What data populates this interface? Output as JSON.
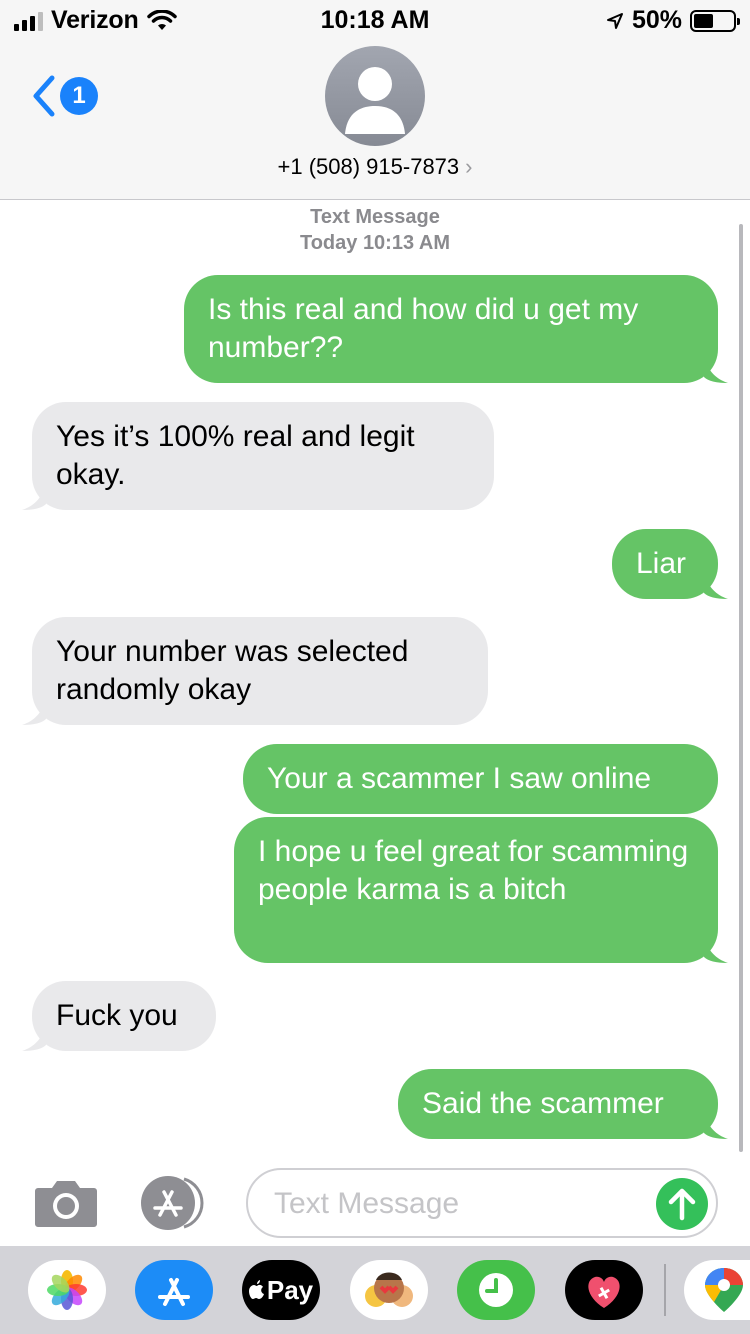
{
  "status_bar": {
    "carrier": "Verizon",
    "time": "10:18 AM",
    "battery": "50%",
    "battery_level": 0.5
  },
  "header": {
    "back_badge": "1",
    "contact": "+1 (508) 915-7873",
    "chevron": "›"
  },
  "conversation": {
    "service": "Text Message",
    "date": "Today 10:13 AM",
    "messages": [
      {
        "from": "me",
        "text": "Is this real and how did u get my number??"
      },
      {
        "from": "them",
        "text": "Yes it’s 100% real and legit okay."
      },
      {
        "from": "me",
        "text": "Liar"
      },
      {
        "from": "them",
        "text": "Your number was selected randomly okay"
      },
      {
        "from": "me",
        "text": "Your a scammer I saw online"
      },
      {
        "from": "me",
        "text": "I hope u feel great for scamming people karma is a bitch"
      },
      {
        "from": "them",
        "text": "Fuck you"
      },
      {
        "from": "me",
        "text": "Said the scammer"
      }
    ]
  },
  "input": {
    "placeholder": "Text Message"
  },
  "dock": {
    "items": [
      {
        "icon": "photos-icon"
      },
      {
        "icon": "app-store-icon"
      },
      {
        "icon": "apple-pay-icon",
        "label": "Pay"
      },
      {
        "icon": "memoji-icon"
      },
      {
        "icon": "clock-icon"
      },
      {
        "icon": "heart-app-icon"
      },
      {
        "icon": "google-maps-icon"
      }
    ]
  },
  "colors": {
    "sent_bubble": "#65c466",
    "received_bubble": "#e9e9eb",
    "accent": "#1a82fb",
    "send_button": "#34c05a"
  }
}
